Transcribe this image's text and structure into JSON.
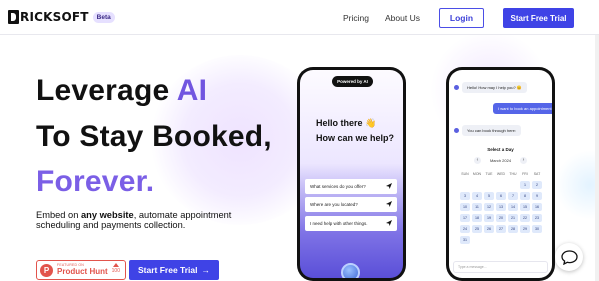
{
  "header": {
    "brand": "RICKSOFT",
    "badge": "Beta",
    "nav": [
      "Pricing",
      "About Us"
    ],
    "login_label": "Login",
    "trial_label": "Start Free Trial"
  },
  "hero": {
    "line1_prefix": "Leverage",
    "line1_accent": "AI",
    "line2": "To Stay Booked,",
    "line3": "Forever.",
    "sub_prefix": "Embed on ",
    "sub_bold": "any website",
    "sub_suffix": ", automate appointment scheduling and payments collection.",
    "product_hunt": {
      "featured": "FEATURED ON",
      "name": "Product Hunt",
      "votes": "100",
      "letter": "P"
    },
    "trial_label": "Start Free Trial",
    "trial_arrow": "→"
  },
  "phone_left": {
    "pill": "Powered by AI",
    "greeting": "Hello there 👋",
    "question": "How can we help?",
    "options": [
      "What services do you offer?",
      "Where are you located?",
      "I need help with other things."
    ]
  },
  "phone_right": {
    "bot_msg1": "Hello! How may I help you? 😊",
    "user_msg": "I want to book an appointment",
    "bot_msg2": "You can book through here:",
    "calendar_title": "Select a Day",
    "month": "March 2024",
    "weekdays": [
      "SUN",
      "MON",
      "TUE",
      "WED",
      "THU",
      "FRI",
      "SAT"
    ],
    "days": [
      "1",
      "2",
      "3",
      "4",
      "5",
      "6",
      "7",
      "8",
      "9",
      "10",
      "11",
      "12",
      "13",
      "14",
      "15",
      "16",
      "17",
      "18",
      "19",
      "20",
      "21",
      "22",
      "23",
      "24",
      "25",
      "26",
      "27",
      "28",
      "29",
      "30",
      "31"
    ],
    "input_placeholder": "Type a message..."
  },
  "colors": {
    "accent": "#3f43e6",
    "ai_purple": "#7155e0",
    "product_hunt": "#e2544c"
  }
}
